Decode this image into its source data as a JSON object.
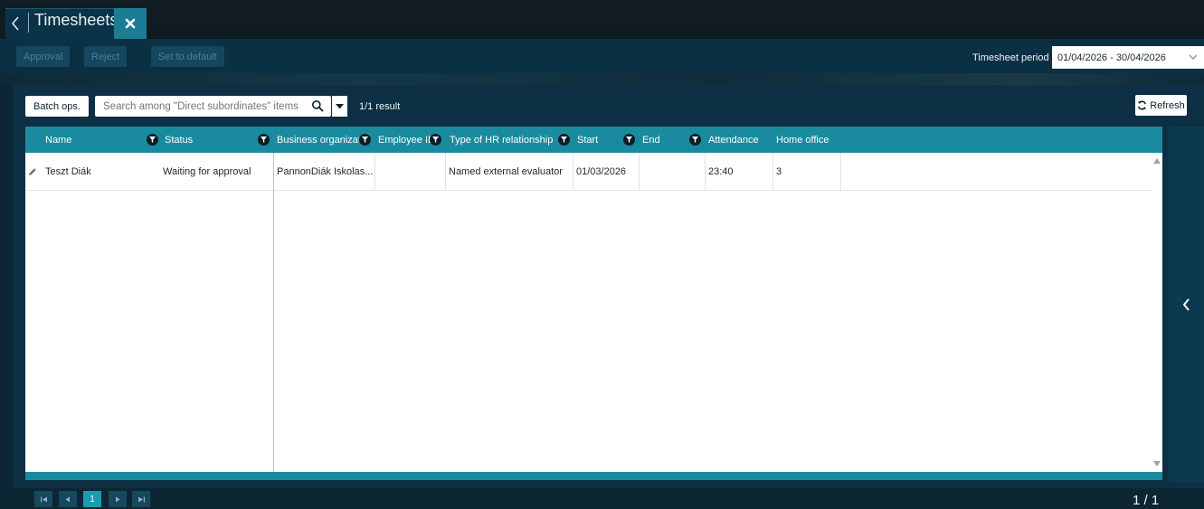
{
  "window": {
    "title": "Timesheets"
  },
  "toolbar": {
    "approval_label": "Approval",
    "reject_label": "Reject",
    "set_default_label": "Set to default",
    "period_label": "Timesheet period",
    "period_value": "01/04/2026 - 30/04/2026"
  },
  "grid_toolbar": {
    "batch_label": "Batch ops.",
    "search_placeholder": "Search among \"Direct subordinates\" items",
    "result_count": "1/1 result",
    "refresh_label": "Refresh"
  },
  "columns": [
    {
      "label": "Name"
    },
    {
      "label": "Status"
    },
    {
      "label": "Business organizat"
    },
    {
      "label": "Employee ID"
    },
    {
      "label": "Type of HR relationship"
    },
    {
      "label": "Start"
    },
    {
      "label": "End"
    },
    {
      "label": "Attendance"
    },
    {
      "label": "Home office"
    }
  ],
  "rows": [
    {
      "name": "Teszt Diák",
      "status": "Waiting for approval",
      "business_org": "PannonDiák Iskolas...",
      "employee_id": "",
      "hr_relationship": "Named external evaluator",
      "start": "01/03/2026",
      "end": "",
      "attendance": "23:40",
      "home_office": "3"
    }
  ],
  "pagination": {
    "current_page": "1",
    "page_indicator": "1 / 1"
  },
  "colors": {
    "header_teal": "#1a8b9e",
    "panel_dark": "#0d3044",
    "titlebar": "#111c23",
    "accent": "#1a9bb1"
  },
  "icons": [
    "back-icon",
    "close-icon",
    "chevron-down-icon",
    "search-icon",
    "caret-down-icon",
    "refresh-icon",
    "filter-icon",
    "edit-icon",
    "scroll-up-icon",
    "scroll-down-icon",
    "collapse-left-icon",
    "first-page-icon",
    "prev-page-icon",
    "next-page-icon",
    "last-page-icon"
  ]
}
